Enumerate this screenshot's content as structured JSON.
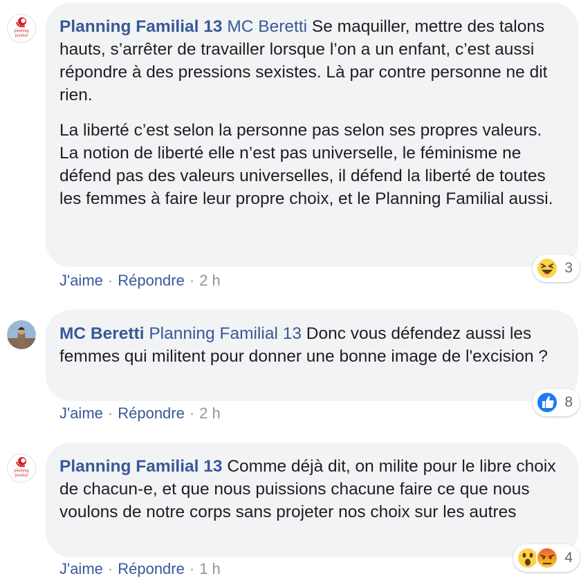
{
  "comments": [
    {
      "author": "Planning Familial 13",
      "mention": "MC Beretti",
      "para1": " Se maquiller, mettre des talons hauts, s’arrêter de travailler lorsque l’on a un enfant, c’est aussi répondre à des pressions sexistes. Là par contre personne ne dit rien.",
      "para2_line1": "La liberté c’est selon la personne pas selon ses propres valeurs.",
      "para2_line2": "La notion de liberté elle n’est pas universelle, le féminisme ne défend pas des valeurs universelles, il défend la liberté de toutes les femmes à faire leur propre choix, et le Planning Familial aussi.",
      "like_label": "J'aime",
      "reply_label": "Répondre",
      "time": "2 h",
      "reaction_count": "3",
      "reaction_icons": [
        "laugh-icon"
      ]
    },
    {
      "author": "MC Beretti",
      "mention": "Planning Familial 13",
      "text": " Donc vous défendez aussi les femmes qui militent pour donner une bonne image de l'excision ?",
      "like_label": "J'aime",
      "reply_label": "Répondre",
      "time": "2 h",
      "reaction_count": "8",
      "reaction_icons": [
        "like-icon"
      ]
    },
    {
      "author": "Planning Familial 13",
      "text": " Comme déjà dit, on milite pour le libre choix de chacun-e, et que nous puissions chacune faire ce que nous voulons de notre corps sans projeter nos choix sur les autres",
      "like_label": "J'aime",
      "reply_label": "Répondre",
      "time": "1 h",
      "reaction_count": "4",
      "reaction_icons": [
        "wow-icon",
        "angry-icon"
      ]
    }
  ],
  "avatar_logo_text": "planning familial",
  "colors": {
    "link": "#385898",
    "bubble": "#f2f3f5",
    "meta": "#90949c",
    "like_blue": "#2078f4",
    "emoji_yellow": "#fcd34d",
    "angry_red": "#e9573f",
    "logo_red": "#d71a21"
  }
}
